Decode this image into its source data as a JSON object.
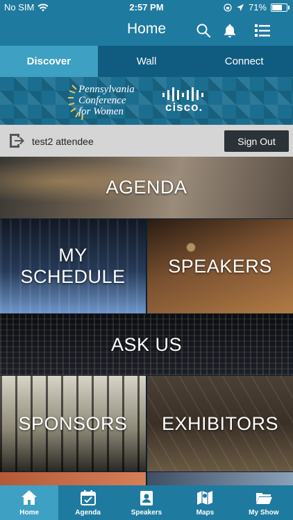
{
  "status": {
    "carrier": "No SIM",
    "time": "2:57 PM",
    "battery": "71%"
  },
  "header": {
    "title": "Home"
  },
  "tabs": [
    {
      "label": "Discover",
      "active": true
    },
    {
      "label": "Wall",
      "active": false
    },
    {
      "label": "Connect",
      "active": false
    }
  ],
  "banner": {
    "conference_text": "Pennsylvania\nConference\nfor Women",
    "sponsor_text": "cisco."
  },
  "user": {
    "name": "test2 attendee",
    "signout_label": "Sign Out"
  },
  "tiles": {
    "agenda": "AGENDA",
    "my_schedule": "MY SCHEDULE",
    "speakers": "SPEAKERS",
    "ask_us": "ASK US",
    "sponsors": "SPONSORS",
    "exhibitors": "EXHIBITORS"
  },
  "bottom_nav": [
    {
      "label": "Home",
      "icon": "home-icon",
      "active": true
    },
    {
      "label": "Agenda",
      "icon": "calendar-icon",
      "active": false
    },
    {
      "label": "Speakers",
      "icon": "speaker-badge-icon",
      "active": false
    },
    {
      "label": "Maps",
      "icon": "map-icon",
      "active": false
    },
    {
      "label": "My Show",
      "icon": "folder-icon",
      "active": false
    }
  ],
  "colors": {
    "primary": "#1f7aa0",
    "active_tab": "#3ea0c2",
    "signout_bg": "#2b3238",
    "userbar_bg": "#d5d5d5"
  }
}
